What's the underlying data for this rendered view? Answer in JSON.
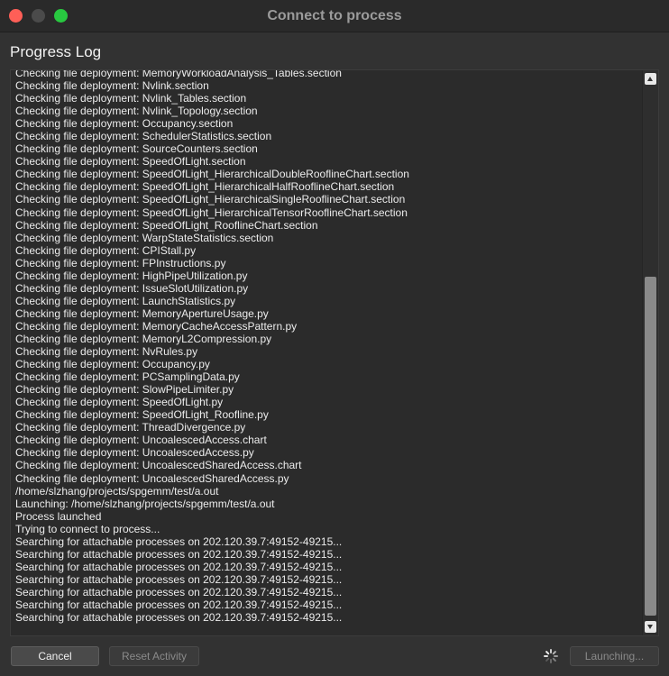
{
  "window": {
    "title": "Connect to process"
  },
  "section": {
    "title": "Progress Log"
  },
  "log": {
    "lines": [
      "Checking file deployment: MemoryWorkloadAnalysis_Tables.section",
      "Checking file deployment: Nvlink.section",
      "Checking file deployment: Nvlink_Tables.section",
      "Checking file deployment: Nvlink_Topology.section",
      "Checking file deployment: Occupancy.section",
      "Checking file deployment: SchedulerStatistics.section",
      "Checking file deployment: SourceCounters.section",
      "Checking file deployment: SpeedOfLight.section",
      "Checking file deployment: SpeedOfLight_HierarchicalDoubleRooflineChart.section",
      "Checking file deployment: SpeedOfLight_HierarchicalHalfRooflineChart.section",
      "Checking file deployment: SpeedOfLight_HierarchicalSingleRooflineChart.section",
      "Checking file deployment: SpeedOfLight_HierarchicalTensorRooflineChart.section",
      "Checking file deployment: SpeedOfLight_RooflineChart.section",
      "Checking file deployment: WarpStateStatistics.section",
      "Checking file deployment: CPIStall.py",
      "Checking file deployment: FPInstructions.py",
      "Checking file deployment: HighPipeUtilization.py",
      "Checking file deployment: IssueSlotUtilization.py",
      "Checking file deployment: LaunchStatistics.py",
      "Checking file deployment: MemoryApertureUsage.py",
      "Checking file deployment: MemoryCacheAccessPattern.py",
      "Checking file deployment: MemoryL2Compression.py",
      "Checking file deployment: NvRules.py",
      "Checking file deployment: Occupancy.py",
      "Checking file deployment: PCSamplingData.py",
      "Checking file deployment: SlowPipeLimiter.py",
      "Checking file deployment: SpeedOfLight.py",
      "Checking file deployment: SpeedOfLight_Roofline.py",
      "Checking file deployment: ThreadDivergence.py",
      "Checking file deployment: UncoalescedAccess.chart",
      "Checking file deployment: UncoalescedAccess.py",
      "Checking file deployment: UncoalescedSharedAccess.chart",
      "Checking file deployment: UncoalescedSharedAccess.py",
      "/home/slzhang/projects/spgemm/test/a.out",
      "Launching: /home/slzhang/projects/spgemm/test/a.out",
      "Process launched",
      "Trying to connect to process...",
      "Searching for attachable processes on 202.120.39.7:49152-49215...",
      "Searching for attachable processes on 202.120.39.7:49152-49215...",
      "Searching for attachable processes on 202.120.39.7:49152-49215...",
      "Searching for attachable processes on 202.120.39.7:49152-49215...",
      "Searching for attachable processes on 202.120.39.7:49152-49215...",
      "Searching for attachable processes on 202.120.39.7:49152-49215...",
      "Searching for attachable processes on 202.120.39.7:49152-49215..."
    ]
  },
  "buttons": {
    "cancel": "Cancel",
    "reset": "Reset Activity",
    "launch": "Launching..."
  },
  "icons": {
    "scroll_up": "scroll-up-arrow-icon",
    "scroll_down": "scroll-down-arrow-icon",
    "spinner": "loading-spinner-icon"
  },
  "colors": {
    "close": "#fe5f57",
    "minimize": "#4b4b4b",
    "maximize": "#28c840"
  }
}
